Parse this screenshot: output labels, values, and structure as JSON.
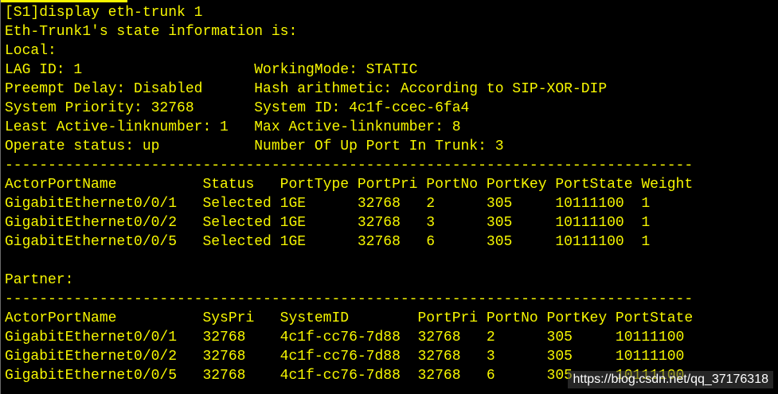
{
  "terminal": {
    "fg_color": "#f7f700",
    "bg_color": "#000000",
    "lines": [
      "[S1]display eth-trunk 1",
      "Eth-Trunk1's state information is:",
      "Local:",
      "LAG ID: 1                    WorkingMode: STATIC",
      "Preempt Delay: Disabled      Hash arithmetic: According to SIP-XOR-DIP",
      "System Priority: 32768       System ID: 4c1f-ccec-6fa4",
      "Least Active-linknumber: 1   Max Active-linknumber: 8",
      "Operate status: up           Number Of Up Port In Trunk: 3",
      "--------------------------------------------------------------------------------",
      "ActorPortName          Status   PortType PortPri PortNo PortKey PortState Weight",
      "GigabitEthernet0/0/1   Selected 1GE      32768   2      305     10111100  1",
      "GigabitEthernet0/0/2   Selected 1GE      32768   3      305     10111100  1",
      "GigabitEthernet0/0/5   Selected 1GE      32768   6      305     10111100  1",
      "",
      "Partner:",
      "--------------------------------------------------------------------------------",
      "ActorPortName          SysPri   SystemID        PortPri PortNo PortKey PortState",
      "GigabitEthernet0/0/1   32768    4c1f-cc76-7d88  32768   2      305     10111100",
      "GigabitEthernet0/0/2   32768    4c1f-cc76-7d88  32768   3      305     10111100",
      "GigabitEthernet0/0/5   32768    4c1f-cc76-7d88  32768   6      305     10111100"
    ]
  },
  "watermark": {
    "text": "https://blog.csdn.net/qq_37176318"
  }
}
